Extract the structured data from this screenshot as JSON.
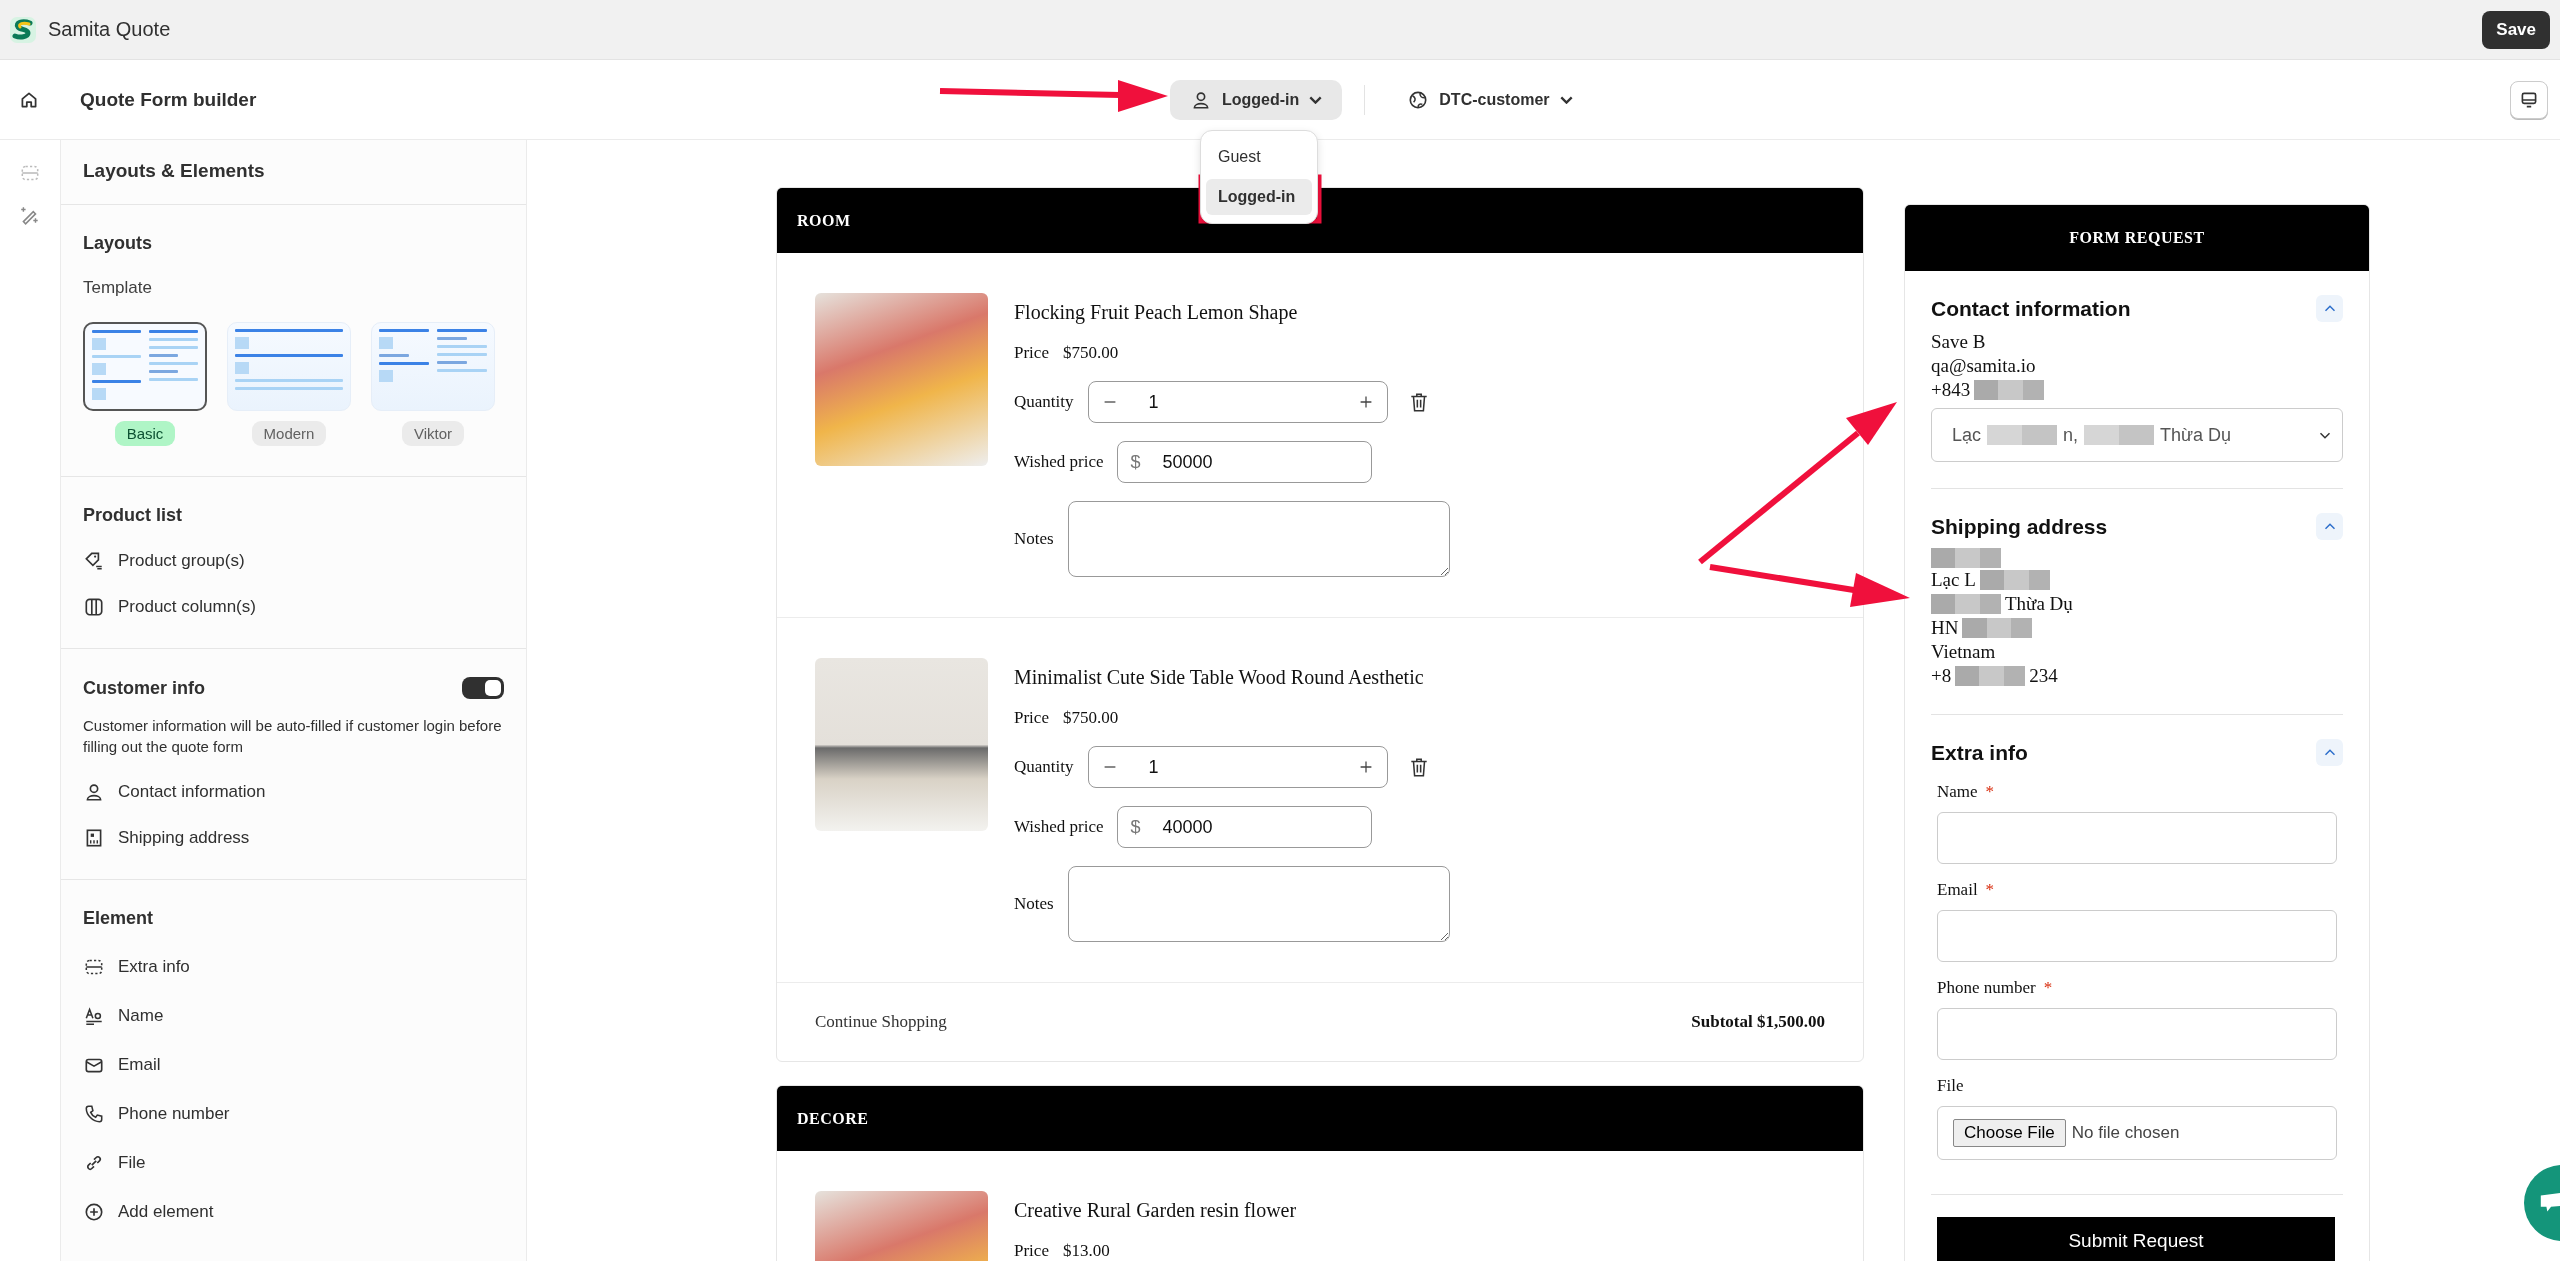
{
  "app": {
    "name": "Samita Quote",
    "save_label": "Save"
  },
  "toolbar": {
    "title": "Quote Form builder",
    "customer_mode": {
      "label": "Logged-in",
      "expanded": true,
      "options": [
        {
          "label": "Guest",
          "selected": false
        },
        {
          "label": "Logged-in",
          "selected": true
        }
      ]
    },
    "market": {
      "label": "DTC-customer"
    }
  },
  "sidebar": {
    "title": "Layouts & Elements",
    "layouts": {
      "heading": "Layouts",
      "template_label": "Template",
      "templates": [
        {
          "label": "Basic",
          "kind": "basic",
          "selected": true
        },
        {
          "label": "Modern",
          "kind": "modern",
          "selected": false
        },
        {
          "label": "Viktor",
          "kind": "viktor",
          "selected": false
        }
      ]
    },
    "product_list": {
      "heading": "Product list",
      "items": [
        {
          "label": "Product group(s)",
          "kind": "tag"
        },
        {
          "label": "Product column(s)",
          "kind": "columns"
        }
      ]
    },
    "customer_info": {
      "heading": "Customer info",
      "on": true,
      "description": "Customer information will be auto-filled if customer login before filling out the quote form",
      "items": [
        {
          "label": "Contact information",
          "kind": "person"
        },
        {
          "label": "Shipping address",
          "kind": "building"
        }
      ]
    },
    "element": {
      "heading": "Element",
      "items": [
        {
          "label": "Extra info",
          "kind": "section"
        },
        {
          "label": "Name",
          "kind": "text"
        },
        {
          "label": "Email",
          "kind": "mail"
        },
        {
          "label": "Phone number",
          "kind": "phone"
        },
        {
          "label": "File",
          "kind": "link"
        },
        {
          "label": "Add element",
          "kind": "add"
        }
      ]
    }
  },
  "groups": [
    {
      "title": "ROOM",
      "products": [
        {
          "name": "Flocking Fruit Peach Lemon Shape",
          "price_label": "Price",
          "price": "$750.00",
          "quantity_label": "Quantity",
          "quantity": "1",
          "wished_label": "Wished price",
          "currency": "$",
          "wished_price": "50000",
          "notes_label": "Notes"
        },
        {
          "name": "Minimalist Cute Side Table Wood Round Aesthetic",
          "price_label": "Price",
          "price": "$750.00",
          "quantity_label": "Quantity",
          "quantity": "1",
          "wished_label": "Wished price",
          "currency": "$",
          "wished_price": "40000",
          "notes_label": "Notes"
        }
      ],
      "footer": {
        "link": "Continue Shopping",
        "subtotal": "Subtotal $1,500.00"
      }
    },
    {
      "title": "DECORE",
      "products": [
        {
          "name": "Creative Rural Garden resin flower",
          "price_label": "Price",
          "price": "$13.00"
        }
      ]
    }
  ],
  "form": {
    "title": "FORM REQUEST",
    "sections": [
      {
        "kind": "contact",
        "title": "Contact information",
        "expanded": true,
        "lines": [
          [
            {
              "text": "Save B"
            }
          ],
          [
            {
              "text": "qa@samita.io"
            }
          ],
          [
            {
              "text": "+843"
            },
            {
              "kind": "redacted"
            }
          ]
        ],
        "select": [
          {
            "text": "Lạc"
          },
          {
            "kind": "redacted"
          },
          {
            "text": "n,"
          },
          {
            "kind": "redacted"
          },
          {
            "text": "Thừa Dụ"
          }
        ]
      },
      {
        "kind": "shipping",
        "title": "Shipping address",
        "expanded": true,
        "lines": [
          [
            {
              "kind": "redacted"
            }
          ],
          [
            {
              "text": "Lạc L"
            },
            {
              "kind": "redacted"
            }
          ],
          [
            {
              "kind": "redacted"
            },
            {
              "text": "Thừa Dụ"
            }
          ],
          [
            {
              "text": "HN"
            },
            {
              "kind": "redacted"
            }
          ],
          [
            {
              "text": "Vietnam"
            }
          ],
          [
            {
              "text": "+8"
            },
            {
              "kind": "redacted"
            },
            {
              "text": "234"
            }
          ]
        ]
      },
      {
        "kind": "extra",
        "title": "Extra info",
        "expanded": true,
        "fields": [
          {
            "label": "Name",
            "required_mark": "*",
            "kind": "text"
          },
          {
            "label": "Email",
            "required_mark": "*",
            "kind": "text"
          },
          {
            "label": "Phone number",
            "required_mark": "*",
            "kind": "text"
          },
          {
            "label": "File",
            "kind": "file",
            "button": "Choose File",
            "status": "No file chosen"
          }
        ]
      }
    ],
    "submit": "Submit Request"
  }
}
